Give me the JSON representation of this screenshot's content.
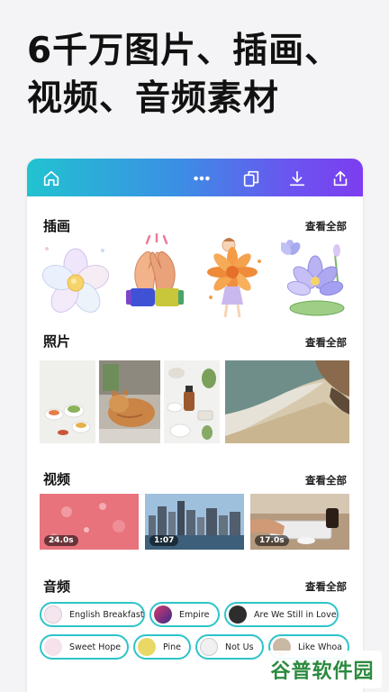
{
  "headline": "6千万图片、插画、视频、音频素材",
  "toolbar": {
    "icons": [
      "home-icon",
      "more-dots-icon",
      "copy-pages-icon",
      "download-icon",
      "share-icon"
    ]
  },
  "sections": {
    "illustrations": {
      "title": "插画",
      "see_all": "查看全部"
    },
    "photos": {
      "title": "照片",
      "see_all": "查看全部"
    },
    "videos": {
      "title": "视频",
      "see_all": "查看全部",
      "items": [
        {
          "duration": "24.0s"
        },
        {
          "duration": "1:07"
        },
        {
          "duration": "17.0s"
        }
      ]
    },
    "audio": {
      "title": "音频",
      "see_all": "查看全部",
      "tracks": [
        {
          "name": "English Breakfast"
        },
        {
          "name": "Empire"
        },
        {
          "name": "Are We Still in Love"
        },
        {
          "name": "Sweet Hope"
        },
        {
          "name": "Pine"
        },
        {
          "name": "Not Us"
        },
        {
          "name": "Like Whoa"
        }
      ]
    }
  },
  "colors": {
    "chip_border": "#2ec4c9",
    "gradient_start": "#21c3d0",
    "gradient_end": "#7d3df0"
  },
  "watermark": "谷普软件园"
}
